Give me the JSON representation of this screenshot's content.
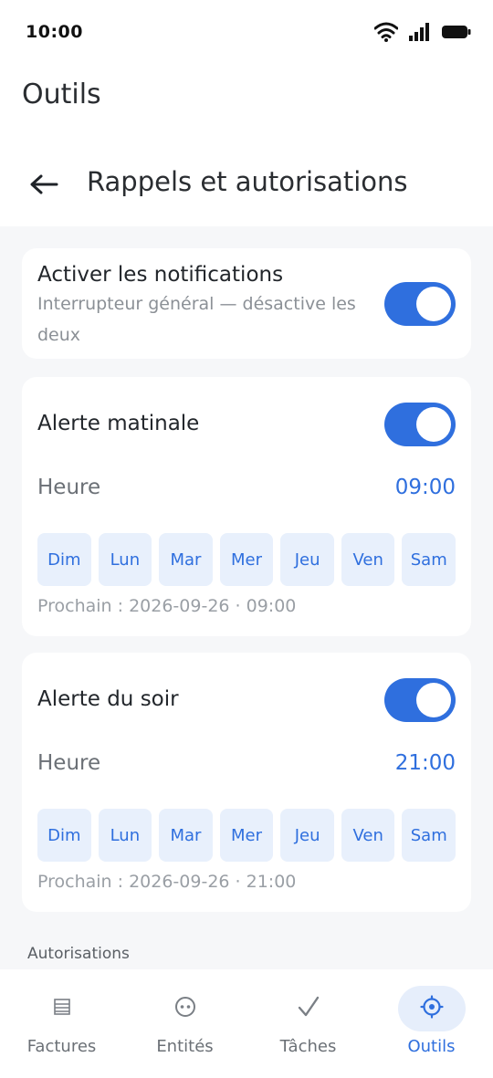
{
  "status_bar": {
    "time": "10:00"
  },
  "app_title": "Outils",
  "toolbar": {
    "title": "Rappels et autorisations"
  },
  "master": {
    "title": "Activer les notifications",
    "subtitle": "Interrupteur général — désactive les deux",
    "enabled": true
  },
  "morning": {
    "title": "Alerte matinale",
    "enabled": true,
    "hour_label": "Heure",
    "hour_value": "09:00",
    "days": [
      "Dim",
      "Lun",
      "Mar",
      "Mer",
      "Jeu",
      "Ven",
      "Sam"
    ],
    "next": "Prochain : 2026-09-26 · 09:00"
  },
  "evening": {
    "title": "Alerte du soir",
    "enabled": true,
    "hour_label": "Heure",
    "hour_value": "21:00",
    "days": [
      "Dim",
      "Lun",
      "Mar",
      "Mer",
      "Jeu",
      "Ven",
      "Sam"
    ],
    "next": "Prochain : 2026-09-26 · 21:00"
  },
  "permissions_heading": "Autorisations",
  "nav": {
    "items": [
      {
        "label": "Factures",
        "icon": "receipt-icon",
        "active": false
      },
      {
        "label": "Entités",
        "icon": "entity-icon",
        "active": false
      },
      {
        "label": "Tâches",
        "icon": "check-icon",
        "active": false
      },
      {
        "label": "Outils",
        "icon": "gear-icon",
        "active": true
      }
    ]
  },
  "colors": {
    "accent": "#2f6fde",
    "chip_bg": "#e8f0fc",
    "background": "#f6f7f9"
  }
}
